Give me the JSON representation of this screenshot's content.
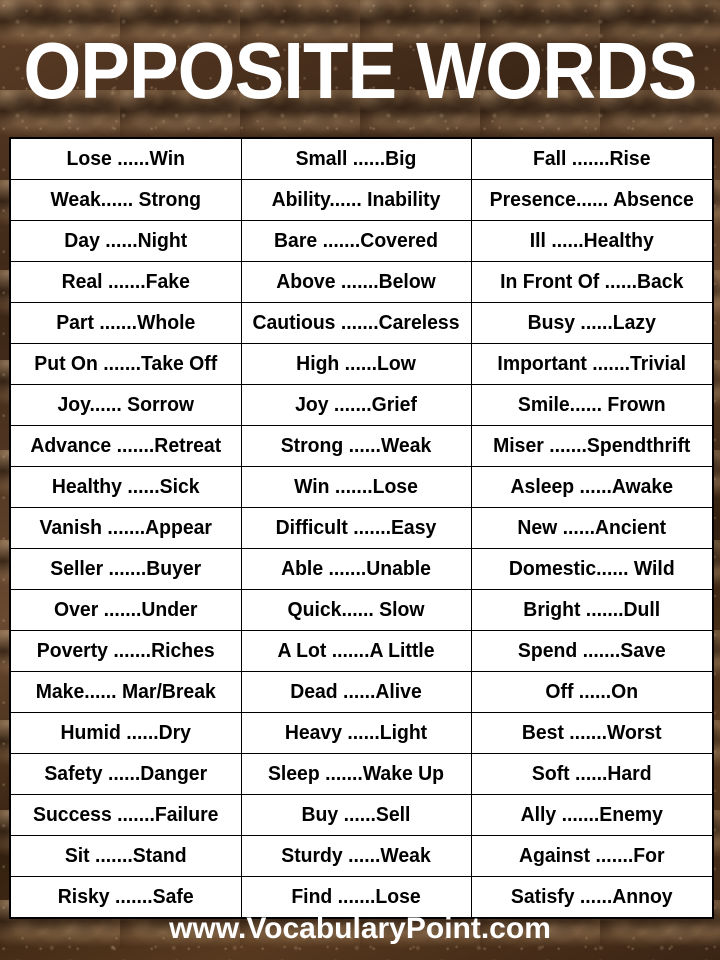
{
  "header": {
    "title": "OPPOSITE WORDS"
  },
  "footer": {
    "website": "www.VocabularyPoint.com"
  },
  "theme": {
    "background_color": "#4b3220",
    "table_background": "#ffffff",
    "border_color": "#000000",
    "title_color": "#ffffff",
    "text_color": "#000000"
  },
  "table": {
    "columns": 3,
    "rows_per_column": 19,
    "entries": [
      [
        "Lose ......Win",
        "Small ......Big",
        "Fall .......Rise"
      ],
      [
        "Weak...... Strong",
        "Ability...... Inability",
        "Presence...... Absence"
      ],
      [
        "Day ......Night",
        "Bare .......Covered",
        "Ill ......Healthy"
      ],
      [
        "Real .......Fake",
        "Above .......Below",
        "In Front Of ......Back"
      ],
      [
        "Part .......Whole",
        "Cautious .......Careless",
        "Busy ......Lazy"
      ],
      [
        "Put On .......Take Off",
        "High ......Low",
        "Important .......Trivial"
      ],
      [
        "Joy...... Sorrow",
        "Joy .......Grief",
        "Smile...... Frown"
      ],
      [
        "Advance .......Retreat",
        "Strong ......Weak",
        "Miser .......Spendthrift"
      ],
      [
        "Healthy ......Sick",
        "Win .......Lose",
        "Asleep ......Awake"
      ],
      [
        "Vanish .......Appear",
        "Difficult .......Easy",
        "New ......Ancient"
      ],
      [
        "Seller .......Buyer",
        "Able .......Unable",
        "Domestic...... Wild"
      ],
      [
        "Over .......Under",
        "Quick...... Slow",
        "Bright .......Dull"
      ],
      [
        "Poverty .......Riches",
        "A Lot .......A Little",
        "Spend .......Save"
      ],
      [
        "Make...... Mar/Break",
        "Dead ......Alive",
        "Off ......On"
      ],
      [
        "Humid ......Dry",
        "Heavy ......Light",
        "Best .......Worst"
      ],
      [
        "Safety ......Danger",
        "Sleep .......Wake Up",
        "Soft ......Hard"
      ],
      [
        "Success .......Failure",
        "Buy ......Sell",
        "Ally .......Enemy"
      ],
      [
        "Sit .......Stand",
        "Sturdy ......Weak",
        "Against .......For"
      ],
      [
        "Risky .......Safe",
        "Find .......Lose",
        "Satisfy ......Annoy"
      ]
    ]
  }
}
